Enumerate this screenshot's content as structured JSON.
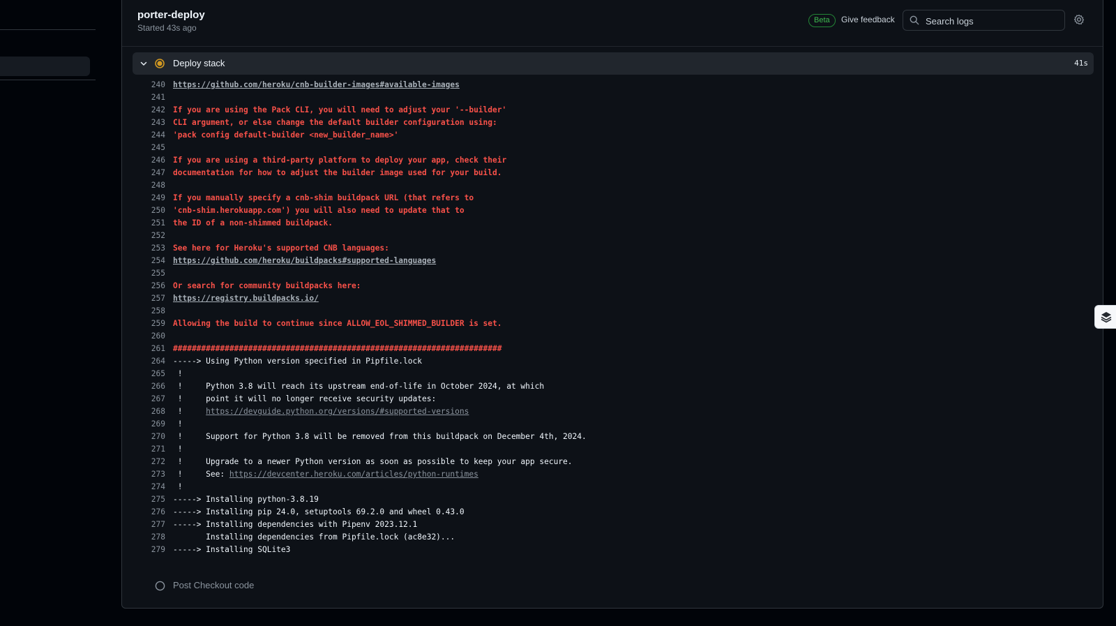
{
  "job": {
    "title": "porter-deploy",
    "started": "Started 43s ago"
  },
  "header": {
    "beta": "Beta",
    "feedback": "Give feedback",
    "search_placeholder": "Search logs"
  },
  "step": {
    "name": "Deploy stack",
    "duration": "41s",
    "status": "in-progress"
  },
  "post_step": {
    "name": "Post Checkout code",
    "status": "pending"
  },
  "icons": {
    "search": "search-icon",
    "settings": "gear-icon",
    "expand": "chevron-down-icon",
    "running": "in-progress-icon",
    "pending": "pending-circle-icon",
    "float": "stack-icon"
  },
  "colors": {
    "error": "#f85149",
    "beta": "#3fb950",
    "running": "#d29922"
  },
  "log_lines": [
    {
      "n": "240",
      "style": "err",
      "parts": [
        {
          "t": "https://github.com/heroku/cnb-builder-images#available-images",
          "link": true
        }
      ]
    },
    {
      "n": "241",
      "style": "err",
      "parts": []
    },
    {
      "n": "242",
      "style": "err",
      "parts": [
        {
          "t": "If you are using the Pack CLI, you will need to adjust your '--builder'"
        }
      ]
    },
    {
      "n": "243",
      "style": "err",
      "parts": [
        {
          "t": "CLI argument, or else change the default builder configuration using:"
        }
      ]
    },
    {
      "n": "244",
      "style": "err",
      "parts": [
        {
          "t": "'pack config default-builder <new_builder_name>'"
        }
      ]
    },
    {
      "n": "245",
      "style": "err",
      "parts": []
    },
    {
      "n": "246",
      "style": "err",
      "parts": [
        {
          "t": "If you are using a third-party platform to deploy your app, check their"
        }
      ]
    },
    {
      "n": "247",
      "style": "err",
      "parts": [
        {
          "t": "documentation for how to adjust the builder image used for your build."
        }
      ]
    },
    {
      "n": "248",
      "style": "err",
      "parts": []
    },
    {
      "n": "249",
      "style": "err",
      "parts": [
        {
          "t": "If you manually specify a cnb-shim buildpack URL (that refers to"
        }
      ]
    },
    {
      "n": "250",
      "style": "err",
      "parts": [
        {
          "t": "'cnb-shim.herokuapp.com') you will also need to update that to"
        }
      ]
    },
    {
      "n": "251",
      "style": "err",
      "parts": [
        {
          "t": "the ID of a non-shimmed buildpack."
        }
      ]
    },
    {
      "n": "252",
      "style": "err",
      "parts": []
    },
    {
      "n": "253",
      "style": "err",
      "parts": [
        {
          "t": "See here for Heroku's supported CNB languages:"
        }
      ]
    },
    {
      "n": "254",
      "style": "err",
      "parts": [
        {
          "t": "https://github.com/heroku/buildpacks#supported-languages",
          "link": true
        }
      ]
    },
    {
      "n": "255",
      "style": "err",
      "parts": []
    },
    {
      "n": "256",
      "style": "err",
      "parts": [
        {
          "t": "Or search for community buildpacks here:"
        }
      ]
    },
    {
      "n": "257",
      "style": "err",
      "parts": [
        {
          "t": "https://registry.buildpacks.io/",
          "link": true
        }
      ]
    },
    {
      "n": "258",
      "style": "err",
      "parts": []
    },
    {
      "n": "259",
      "style": "err",
      "parts": [
        {
          "t": "Allowing the build to continue since ALLOW_EOL_SHIMMED_BUILDER is set."
        }
      ]
    },
    {
      "n": "260",
      "style": "err",
      "parts": []
    },
    {
      "n": "261",
      "style": "err",
      "parts": [
        {
          "t": "######################################################################"
        }
      ]
    },
    {
      "n": "264",
      "style": "norm",
      "parts": [
        {
          "t": "-----> Using Python version specified in Pipfile.lock"
        }
      ]
    },
    {
      "n": "265",
      "style": "norm",
      "parts": [
        {
          "t": " !"
        }
      ]
    },
    {
      "n": "266",
      "style": "norm",
      "parts": [
        {
          "t": " !     Python 3.8 will reach its upstream end-of-life in October 2024, at which"
        }
      ]
    },
    {
      "n": "267",
      "style": "norm",
      "parts": [
        {
          "t": " !     point it will no longer receive security updates:"
        }
      ]
    },
    {
      "n": "268",
      "style": "norm",
      "parts": [
        {
          "t": " !     "
        },
        {
          "t": "https://devguide.python.org/versions/#supported-versions",
          "link": true
        }
      ]
    },
    {
      "n": "269",
      "style": "norm",
      "parts": [
        {
          "t": " !"
        }
      ]
    },
    {
      "n": "270",
      "style": "norm",
      "parts": [
        {
          "t": " !     Support for Python 3.8 will be removed from this buildpack on December 4th, 2024."
        }
      ]
    },
    {
      "n": "271",
      "style": "norm",
      "parts": [
        {
          "t": " !"
        }
      ]
    },
    {
      "n": "272",
      "style": "norm",
      "parts": [
        {
          "t": " !     Upgrade to a newer Python version as soon as possible to keep your app secure."
        }
      ]
    },
    {
      "n": "273",
      "style": "norm",
      "parts": [
        {
          "t": " !     See: "
        },
        {
          "t": "https://devcenter.heroku.com/articles/python-runtimes",
          "link": true
        }
      ]
    },
    {
      "n": "274",
      "style": "norm",
      "parts": [
        {
          "t": " !"
        }
      ]
    },
    {
      "n": "275",
      "style": "norm",
      "parts": [
        {
          "t": "-----> Installing python-3.8.19"
        }
      ]
    },
    {
      "n": "276",
      "style": "norm",
      "parts": [
        {
          "t": "-----> Installing pip 24.0, setuptools 69.2.0 and wheel 0.43.0"
        }
      ]
    },
    {
      "n": "277",
      "style": "norm",
      "parts": [
        {
          "t": "-----> Installing dependencies with Pipenv 2023.12.1"
        }
      ]
    },
    {
      "n": "278",
      "style": "norm",
      "parts": [
        {
          "t": "       Installing dependencies from Pipfile.lock (ac8e32)..."
        }
      ]
    },
    {
      "n": "279",
      "style": "norm",
      "parts": [
        {
          "t": "-----> Installing SQLite3"
        }
      ]
    }
  ]
}
